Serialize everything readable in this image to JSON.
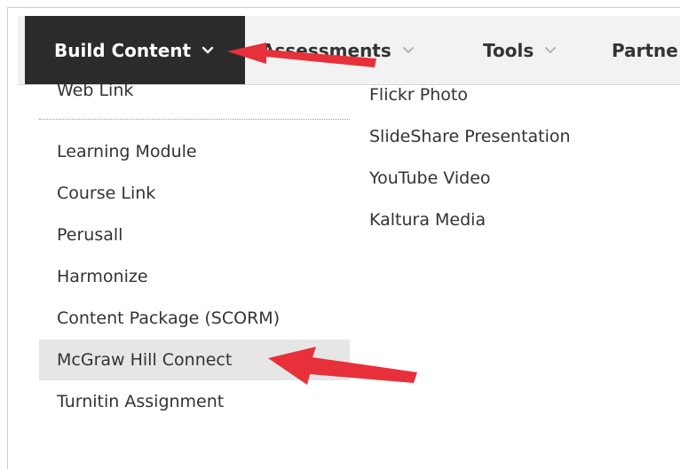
{
  "menubar": {
    "items": [
      {
        "label": "Build Content",
        "icon": "chevron-down-icon",
        "active": true
      },
      {
        "label": "Assessments",
        "icon": "chevron-down-icon",
        "active": false
      },
      {
        "label": "Tools",
        "icon": "chevron-down-icon",
        "active": false
      },
      {
        "label": "Partne",
        "active": false
      }
    ]
  },
  "dropdown": {
    "left_column": [
      {
        "label": "Web Link"
      },
      {
        "label": "Learning Module"
      },
      {
        "label": "Course Link"
      },
      {
        "label": "Perusall"
      },
      {
        "label": "Harmonize"
      },
      {
        "label": "Content Package (SCORM)"
      },
      {
        "label": "McGraw Hill Connect",
        "highlighted": true
      },
      {
        "label": "Turnitin Assignment"
      }
    ],
    "right_column": [
      {
        "label": "Flickr Photo"
      },
      {
        "label": "SlideShare Presentation"
      },
      {
        "label": "YouTube Video"
      },
      {
        "label": "Kaltura Media"
      }
    ]
  },
  "colors": {
    "active_menu_bg": "#2b2b2b",
    "menubar_bg": "#f2f2f2",
    "highlight_bg": "#e6e6e6",
    "annotation_arrow": "#e8303a"
  }
}
